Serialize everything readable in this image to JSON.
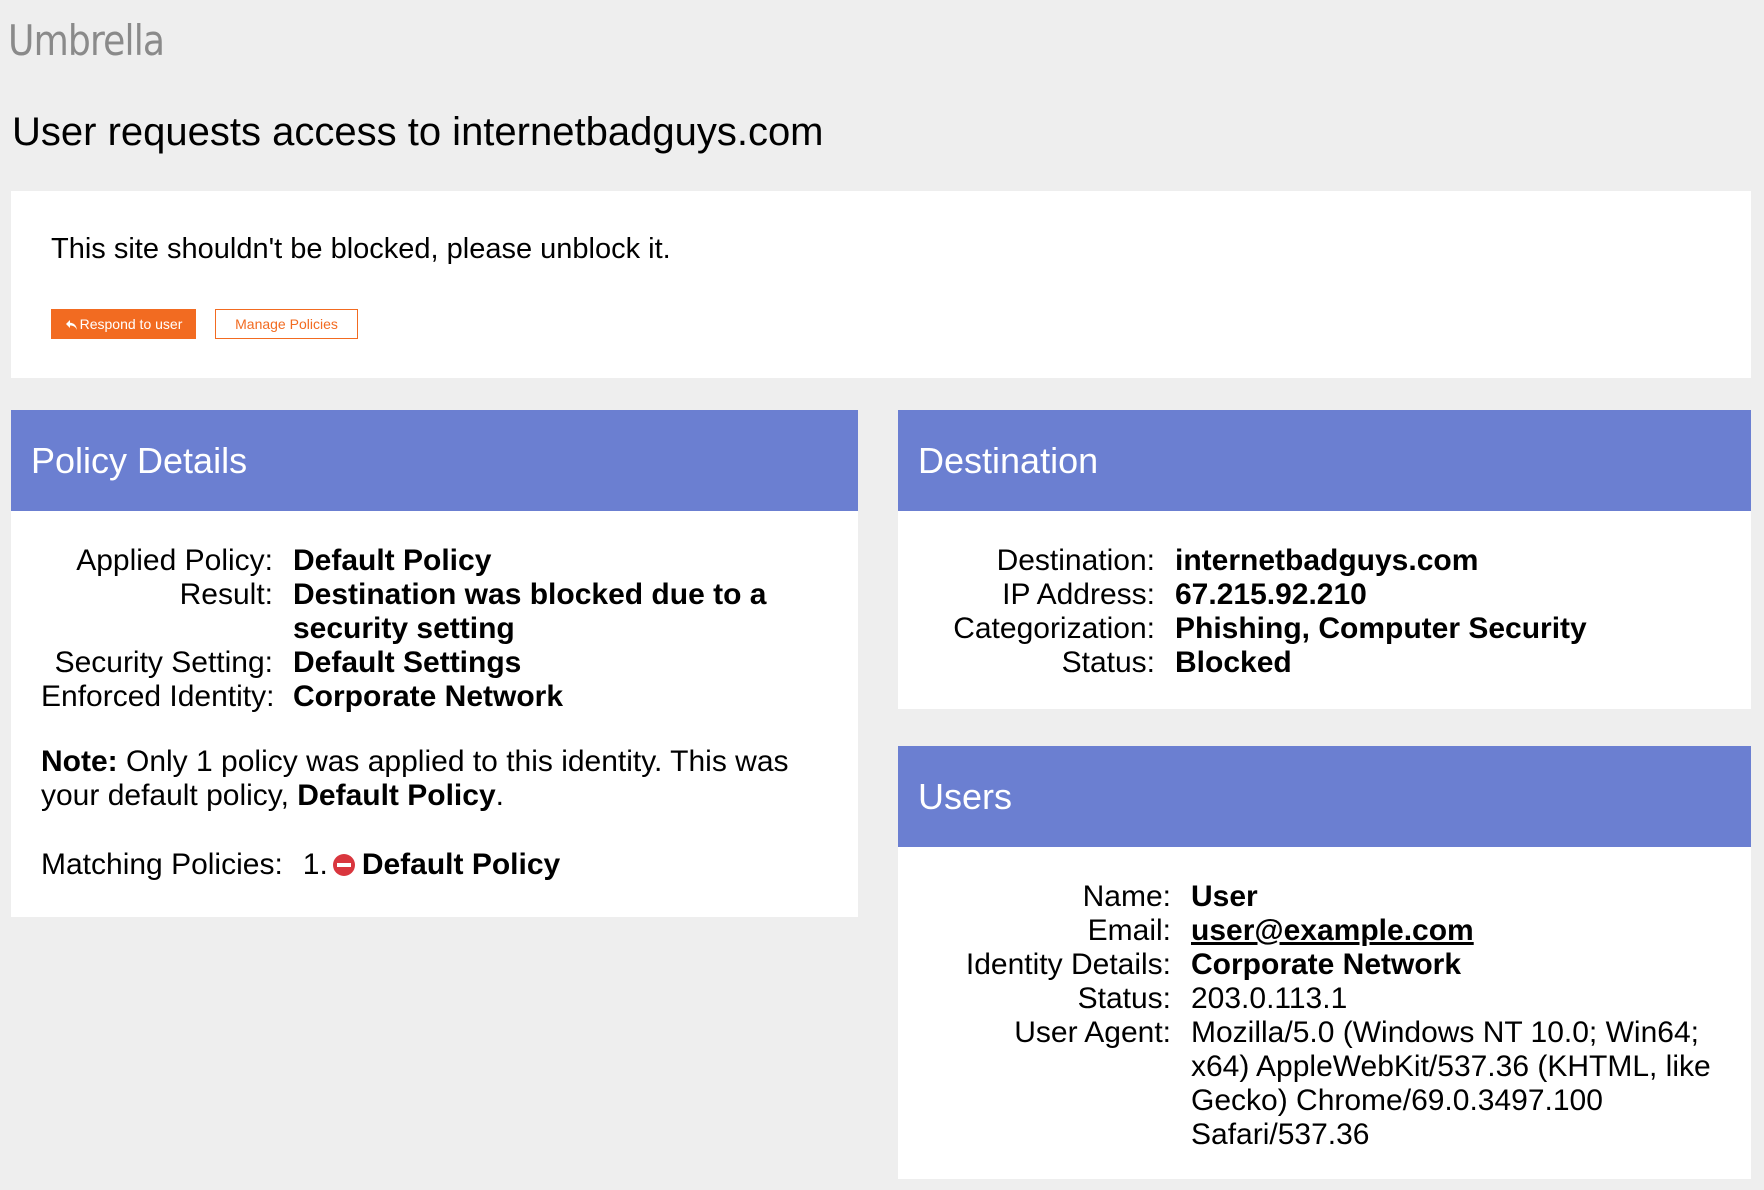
{
  "brand": "Umbrella",
  "page_title": "User requests access to internetbadguys.com",
  "request": {
    "message": "This site shouldn't be blocked, please unblock it.",
    "respond_label": "Respond to user",
    "manage_label": "Manage Policies"
  },
  "colors": {
    "accent": "#f26b21",
    "header": "#6b7fd1",
    "background": "#eeeeee",
    "block_icon": "#d9363e"
  },
  "policy": {
    "title": "Policy Details",
    "applied_policy_label": "Applied Policy:",
    "applied_policy": "Default Policy",
    "result_label": "Result:",
    "result": "Destination was blocked due to a security setting",
    "security_setting_label": "Security Setting:",
    "security_setting": "Default Settings",
    "enforced_identity_label": "Enforced Identity:",
    "enforced_identity": "Corporate Network",
    "note_label": "Note:",
    "note_text": " Only 1 policy was applied to this identity. This was your default policy, ",
    "note_policy": "Default Policy",
    "note_end": ".",
    "matching_label": "Matching Policies:",
    "matching_number": "1.",
    "matching_icon": "blocked-icon",
    "matching_policy": "Default Policy"
  },
  "destination": {
    "title": "Destination",
    "destination_label": "Destination:",
    "destination": "internetbadguys.com",
    "ip_label": "IP Address:",
    "ip": "67.215.92.210",
    "categorization_label": "Categorization:",
    "categorization": "Phishing, Computer Security",
    "status_label": "Status:",
    "status": "Blocked"
  },
  "users": {
    "title": "Users",
    "name_label": "Name:",
    "name": "User",
    "email_label": "Email:",
    "email": "user@example.com",
    "identity_label": "Identity Details:",
    "identity": "Corporate Network",
    "status_label": "Status:",
    "status": "203.0.113.1",
    "agent_label": "User Agent:",
    "agent": "Mozilla/5.0 (Windows NT 10.0; Win64; x64) AppleWebKit/537.36 (KHTML, like Gecko) Chrome/69.0.3497.100 Safari/537.36"
  }
}
